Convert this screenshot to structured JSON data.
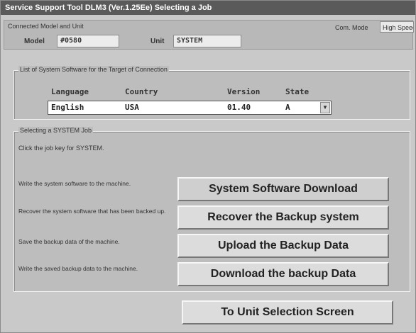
{
  "window": {
    "title": "Service Support Tool DLM3 (Ver.1.25Ee) Selecting a Job"
  },
  "connection": {
    "group_label": "Connected Model and Unit",
    "model_label": "Model",
    "model_value": "#0580",
    "unit_label": "Unit",
    "unit_value": "SYSTEM",
    "com_mode_label": "Com. Mode",
    "com_mode_value": "High Speed"
  },
  "software_list": {
    "title": "List of System Software for the Target of Connection",
    "columns": [
      "Language",
      "Country",
      "Version",
      "State"
    ],
    "row": {
      "language": "English",
      "country": "USA",
      "version": "01.40",
      "state": "A"
    }
  },
  "job_panel": {
    "title": "Selecting a SYSTEM Job",
    "instruction": "Click the job key for SYSTEM.",
    "jobs": [
      {
        "description": "Write the system software to the machine.",
        "button": "System Software Download"
      },
      {
        "description": "Recover the system software that has been backed up.",
        "button": "Recover the Backup system"
      },
      {
        "description": "Save the backup data of the machine.",
        "button": "Upload the Backup Data"
      },
      {
        "description": "Write the saved backup data to the machine.",
        "button": "Download the backup Data"
      }
    ]
  },
  "footer": {
    "button": "To Unit Selection Screen"
  }
}
